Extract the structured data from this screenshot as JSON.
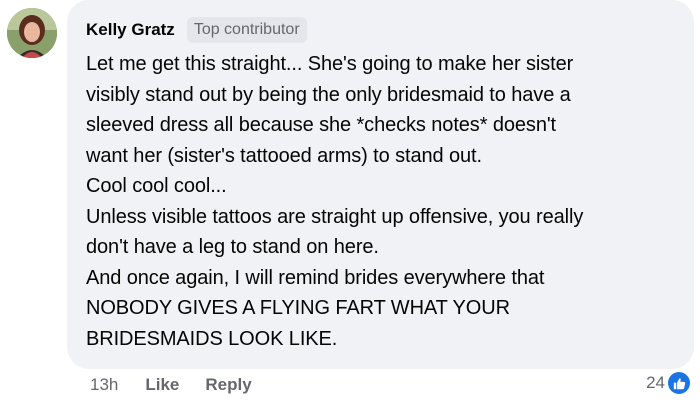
{
  "comment": {
    "author": "Kelly Gratz",
    "badge": "Top contributor",
    "lines": [
      "Let me get this straight... She's going to make her sister",
      "visibly stand out by being the only bridesmaid to have a",
      "sleeved dress all because she *checks notes* doesn't",
      "want her (sister's tattooed arms) to stand out.",
      "Cool cool cool...",
      "Unless visible tattoos are straight up offensive, you really",
      "don't have a leg to stand on here.",
      "And once again, I will remind brides everywhere that",
      "NOBODY GIVES A FLYING FART WHAT YOUR",
      "BRIDESMAIDS LOOK LIKE."
    ]
  },
  "actions": {
    "time": "13h",
    "like_label": "Like",
    "reply_label": "Reply"
  },
  "reactions": {
    "count": "24",
    "icon": "thumbs-up-icon",
    "color": "#1b74e4"
  },
  "colors": {
    "bubble_bg": "#f0f2f5",
    "text": "#050505",
    "secondary_text": "#65676b",
    "badge_bg": "#e4e6eb"
  }
}
